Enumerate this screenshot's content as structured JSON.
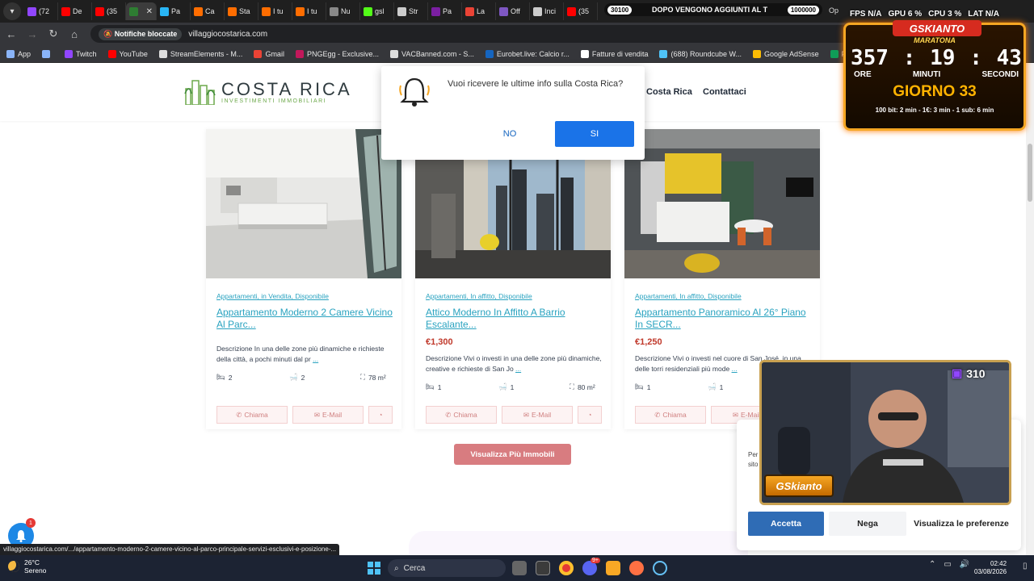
{
  "browser": {
    "tabs": [
      {
        "label": "(72",
        "color": "#9146ff"
      },
      {
        "label": "De",
        "color": "#ff0000"
      },
      {
        "label": "(35",
        "color": "#ff0000"
      },
      {
        "label": "",
        "color": "#2e7d32"
      },
      {
        "label": "Pa",
        "color": "#29b6f6"
      },
      {
        "label": "Ca",
        "color": "#ff6d00"
      },
      {
        "label": "Sta",
        "color": "#ff6d00"
      },
      {
        "label": "I tu",
        "color": "#ff6d00"
      },
      {
        "label": "I tu",
        "color": "#ff6d00"
      },
      {
        "label": "Nu",
        "color": "#888888"
      },
      {
        "label": "gsl",
        "color": "#53fc18"
      },
      {
        "label": "Str",
        "color": "#cccccc"
      },
      {
        "label": "Pa",
        "color": "#7b1fa2"
      },
      {
        "label": "La",
        "color": "#ea4335"
      },
      {
        "label": "Off",
        "color": "#7e57c2"
      },
      {
        "label": "Inci",
        "color": "#cccccc"
      },
      {
        "label": "(35",
        "color": "#ff0000"
      }
    ],
    "ticker": {
      "left_num": "30100",
      "text": "DOPO VENGONO AGGIUNTI AL T",
      "right_num": "1000000",
      "suffix": "Op"
    },
    "url": "villaggiocostarica.com",
    "notifications_blocked": "Notifiche bloccate",
    "bookmarks": [
      {
        "label": "App",
        "color": "#8ab4f8"
      },
      {
        "label": "",
        "color": "#8ab4f8"
      },
      {
        "label": "Twitch",
        "color": "#9146ff"
      },
      {
        "label": "YouTube",
        "color": "#ff0000"
      },
      {
        "label": "StreamElements - M...",
        "color": "#dddddd"
      },
      {
        "label": "Gmail",
        "color": "#ea4335"
      },
      {
        "label": "PNGEgg - Exclusive...",
        "color": "#c2185b"
      },
      {
        "label": "VACBanned.com - S...",
        "color": "#dddddd"
      },
      {
        "label": "Eurobet.live: Calcio r...",
        "color": "#1565c0"
      },
      {
        "label": "Fatture di vendita",
        "color": "#ffffff"
      },
      {
        "label": "(688) Roundcube W...",
        "color": "#4fc3f7"
      },
      {
        "label": "Google AdSense",
        "color": "#fbbc04"
      },
      {
        "label": "Fogli Google",
        "color": "#0f9d58"
      },
      {
        "label": "txAdmin",
        "color": "#2e7d32"
      }
    ]
  },
  "site": {
    "logo_title": "COSTA RICA",
    "logo_subtitle": "INVESTIMENTI IMMOBILIARI",
    "nav": {
      "costa_rica": "Costa Rica",
      "contattaci": "Contattaci"
    },
    "listings": [
      {
        "tags": "Appartamenti, in Vendita, Disponibile",
        "title": "Appartamento Moderno 2 Camere Vicino Al Parc...",
        "price": "",
        "description": "Descrizione In una delle zone più dinamiche e richieste della città, a pochi minuti dal pr",
        "more": "...",
        "beds": "2",
        "baths": "2",
        "area": "78 m²",
        "actions": {
          "call": "Chiama",
          "email": "E-Mail"
        }
      },
      {
        "tags": "Appartamenti, In affitto, Disponibile",
        "title": "Attico Moderno In Affitto A Barrio Escalante...",
        "price": "€1,300",
        "description": "Descrizione Vivi o investi in una delle zone più dinamiche, creative e richieste di San Jo",
        "more": "...",
        "beds": "1",
        "baths": "1",
        "area": "80 m²",
        "actions": {
          "call": "Chiama",
          "email": "E-Mail"
        }
      },
      {
        "tags": "Appartamenti, In affitto, Disponibile",
        "title": "Appartamento Panoramico Al 26° Piano In SECR...",
        "price": "€1,250",
        "description": "Descrizione Vivi o investi nel cuore di San José, in una delle torri residenziali più mode",
        "more": "...",
        "beds": "1",
        "baths": "1",
        "area": "",
        "actions": {
          "call": "Chiama",
          "email": "E-Mail"
        }
      }
    ],
    "view_more": "Visualizza Più Immobili"
  },
  "notification_prompt": {
    "text": "Vuoi ricevere le ultime info sulla Costa Rica?",
    "no": "NO",
    "yes": "SI"
  },
  "cookie": {
    "text_fragments": "Per e/o per sito car",
    "accept": "Accetta",
    "deny": "Nega",
    "preferences": "Visualizza le preferenze"
  },
  "bell_badge": "1",
  "status_url": "villaggiocostarica.com/.../appartamento-moderno-2-camere-vicino-al-parco-principale-servizi-esclusivi-e-posizione-...",
  "stream": {
    "stats": {
      "fps_label": "FPS",
      "fps": "N/A",
      "gpu_label": "GPU",
      "gpu": "6 %",
      "cpu_label": "CPU",
      "cpu": "3 %",
      "lat_label": "LAT",
      "lat": "N/A"
    },
    "timer": {
      "brand": "GSKIANTO",
      "subtitle": "MARATONA",
      "hours": "357",
      "minutes": "19",
      "seconds": "43",
      "hours_label": "ORE",
      "minutes_label": "MINUTI",
      "seconds_label": "SECONDI",
      "day": "GIORNO 33",
      "rates": "100 bit: 2 min - 1€: 3 min - 1 sub: 6 min"
    },
    "sub_count": "310",
    "cam_logo": "GSkianto"
  },
  "taskbar": {
    "temp": "26°C",
    "weather": "Sereno",
    "search": "Cerca",
    "time": "02:42",
    "date": "03/08/2026",
    "discord_badge": "9+"
  }
}
